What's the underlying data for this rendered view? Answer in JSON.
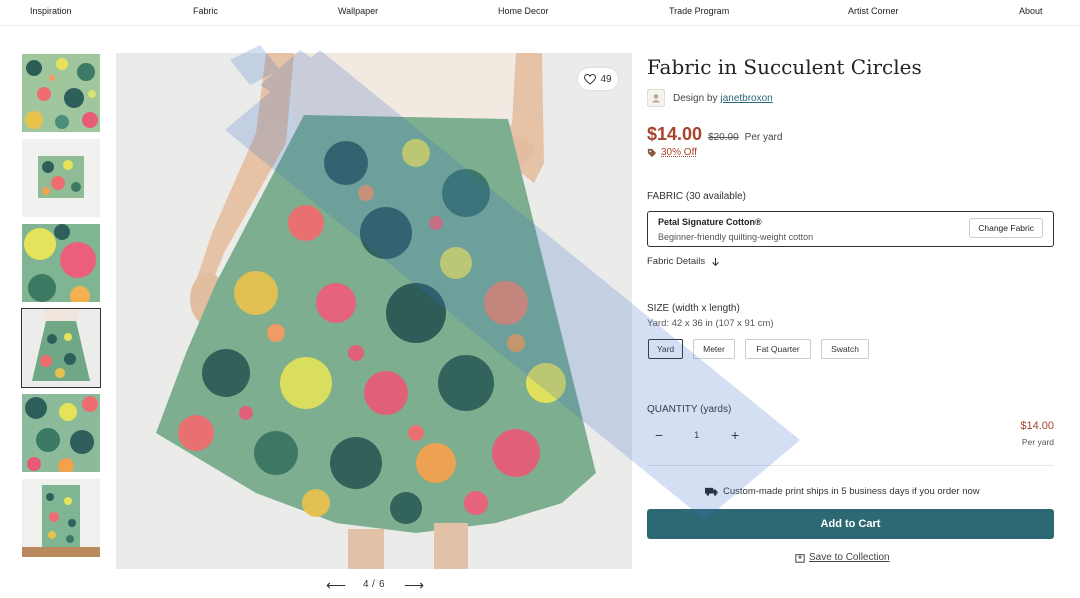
{
  "nav": {
    "items": [
      "Inspiration",
      "Fabric",
      "Wallpaper",
      "Home Decor",
      "Trade Program",
      "Artist Corner",
      "About"
    ]
  },
  "gallery": {
    "favorite_count": "49",
    "pager_current": "4",
    "pager_sep": "/",
    "pager_total": "6",
    "prev_arrow": "⟵",
    "next_arrow": "⟶",
    "active_thumb_index": 4
  },
  "product": {
    "title": "Fabric in Succulent Circles",
    "design_by_label": "Design by",
    "designer": "janetbroxon",
    "price": "$14.00",
    "original_price": "$20.00",
    "price_unit": "Per yard",
    "discount": "30% Off"
  },
  "fabric": {
    "label": "FABRIC (30 available)",
    "name": "Petal Signature Cotton®",
    "description": "Beginner-friendly quilting-weight cotton",
    "change_button": "Change Fabric",
    "details_link": "Fabric Details"
  },
  "size": {
    "label": "SIZE (width x length)",
    "dimensions": "Yard: 42 x 36 in (107 x 91 cm)",
    "options": [
      "Yard",
      "Meter",
      "Fat Quarter",
      "Swatch"
    ],
    "selected": "Yard"
  },
  "quantity": {
    "label": "QUANTITY (yards)",
    "value": "1",
    "minus": "−",
    "plus": "+",
    "line_price": "$14.00",
    "line_unit": "Per yard"
  },
  "shipping": {
    "message": "Custom-made print ships in 5 business days if you order now"
  },
  "actions": {
    "add_to_cart": "Add to Cart",
    "save_to_collection": "Save to Collection"
  },
  "colors": {
    "accent": "#2d6972",
    "price": "#a8432b"
  }
}
